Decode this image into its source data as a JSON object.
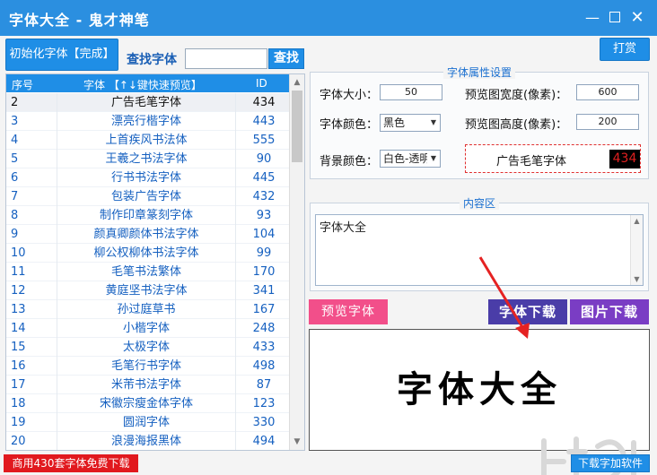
{
  "window": {
    "title": "字体大全 - 鬼才神笔",
    "min": "—",
    "close": "✕"
  },
  "toolbar": {
    "init_label": "初始化字体【完成】",
    "find_label": "查找字体",
    "find_value": "",
    "find_button": "查找",
    "reward_button": "打赏"
  },
  "list": {
    "headers": {
      "no": "序号",
      "name": "字体 【↑↓键快速预览】",
      "id": "ID"
    },
    "rows": [
      {
        "no": "2",
        "name": "广告毛笔字体",
        "id": "434"
      },
      {
        "no": "3",
        "name": "漂亮行楷字体",
        "id": "443"
      },
      {
        "no": "4",
        "name": "上首疾风书法体",
        "id": "555"
      },
      {
        "no": "5",
        "name": "王羲之书法字体",
        "id": "90"
      },
      {
        "no": "6",
        "name": "行书书法字体",
        "id": "445"
      },
      {
        "no": "7",
        "name": "包装广告字体",
        "id": "432"
      },
      {
        "no": "8",
        "name": "制作印章篆刻字体",
        "id": "93"
      },
      {
        "no": "9",
        "name": "颜真卿颜体书法字体",
        "id": "104"
      },
      {
        "no": "10",
        "name": "柳公权柳体书法字体",
        "id": "99"
      },
      {
        "no": "11",
        "name": "毛笔书法繁体",
        "id": "170"
      },
      {
        "no": "12",
        "name": "黄庭坚书法字体",
        "id": "341"
      },
      {
        "no": "13",
        "name": "孙过庭草书",
        "id": "167"
      },
      {
        "no": "14",
        "name": "小楷字体",
        "id": "248"
      },
      {
        "no": "15",
        "name": "太极字体",
        "id": "433"
      },
      {
        "no": "16",
        "name": "毛笔行书字体",
        "id": "498"
      },
      {
        "no": "17",
        "name": "米芾书法字体",
        "id": "87"
      },
      {
        "no": "18",
        "name": "宋徽宗瘦金体字体",
        "id": "123"
      },
      {
        "no": "19",
        "name": "圆润字体",
        "id": "330"
      },
      {
        "no": "20",
        "name": "浪漫海报黑体",
        "id": "494"
      }
    ]
  },
  "attributes": {
    "legend": "字体属性设置",
    "size_label": "字体大小：",
    "size_value": "50",
    "color_label": "字体颜色：",
    "color_value": "黑色",
    "bg_label": "背景颜色：",
    "bg_value": "白色-透明",
    "width_label": "预览图宽度(像素)：",
    "width_value": "600",
    "height_label": "预览图高度(像素)：",
    "height_value": "200",
    "preview_font": "广告毛笔字体",
    "preview_id": "434"
  },
  "content": {
    "legend": "内容区",
    "text": "字体大全"
  },
  "actions": {
    "preview": "预览字体",
    "font_download": "字体下载",
    "image_download": "图片下载"
  },
  "canvas_text": "字体大全",
  "footer": {
    "promo": "商用430套字体免费下载",
    "download_add": "下载字加软件"
  },
  "colors": {
    "accent": "#1f8ee6",
    "titlebar": "#2b8fe0",
    "pink": "#f24f8a",
    "indigo": "#4a3da8",
    "purple": "#7a3dc4",
    "red": "#e1191e"
  }
}
